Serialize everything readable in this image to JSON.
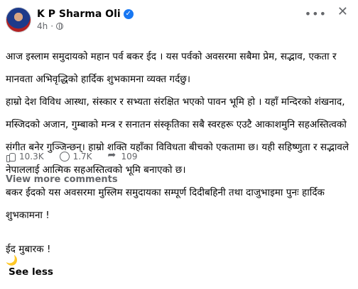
{
  "post": {
    "author": "K P Sharma Oli",
    "time": "4h",
    "lines": [
      "आज इस्लाम समुदायको महान पर्व बकर ईद । यस पर्वको अवसरमा सबैमा प्रेम, सद्भाव, एकता र",
      "मानवता अभिवृद्धिको हार्दिक शुभकामना व्यक्त गर्दछु।",
      "हाम्रो देश विविध आस्था, संस्कार र सभ्यता संरक्षित भएको पावन भूमि हो । यहाँ मन्दिरको शंखनाद,",
      "मस्जिदको अजान, गुम्बाको मन्त्र र सनातन संस्कृतिका सबै स्वरहरू एउटै आकाशमुनि सहअस्तित्वको",
      "संगीत बनेर गुञ्जिन्छन्। हाम्रो शक्ति यहाँका विविधता बीचको एकतामा छ। यही सहिष्णुता र सद्भावले",
      "नेपाललाई आत्मिक सहअस्तित्वको भूमि बनाएको छ।",
      "बकर ईदको यस अवसरमा मुस्लिम समुदायका सम्पूर्ण दिदीबहिनी तथा दाजुभाइमा पुनः हार्दिक",
      "शुभकामना !"
    ],
    "last_line": "ईद मुबारक !",
    "moon_icon": "🌙",
    "see_less": "See less"
  },
  "stats": {
    "likes": "10.3K",
    "comments": "1.7K",
    "shares": "109"
  },
  "footer": {
    "view_more": "View more comments"
  }
}
